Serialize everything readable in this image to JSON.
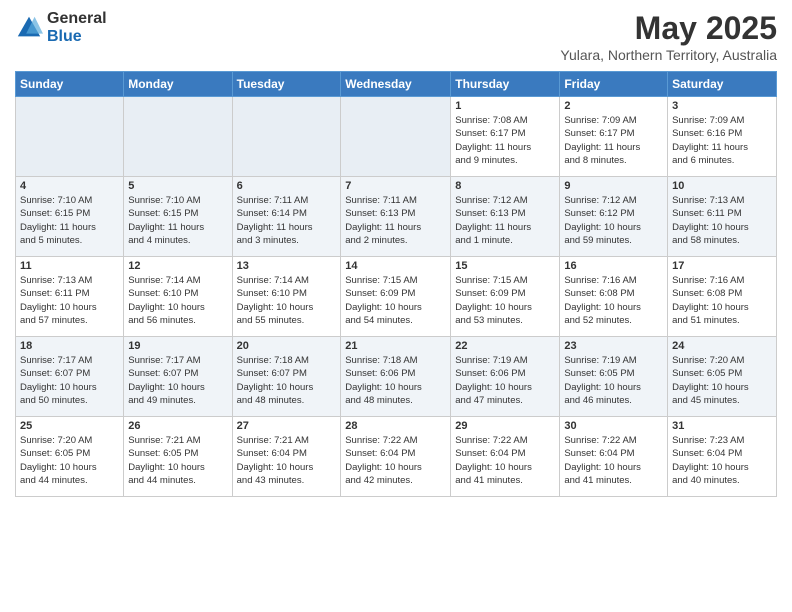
{
  "header": {
    "logo_general": "General",
    "logo_blue": "Blue",
    "month_year": "May 2025",
    "location": "Yulara, Northern Territory, Australia"
  },
  "days_of_week": [
    "Sunday",
    "Monday",
    "Tuesday",
    "Wednesday",
    "Thursday",
    "Friday",
    "Saturday"
  ],
  "weeks": [
    [
      {
        "day": "",
        "info": ""
      },
      {
        "day": "",
        "info": ""
      },
      {
        "day": "",
        "info": ""
      },
      {
        "day": "",
        "info": ""
      },
      {
        "day": "1",
        "info": "Sunrise: 7:08 AM\nSunset: 6:17 PM\nDaylight: 11 hours\nand 9 minutes."
      },
      {
        "day": "2",
        "info": "Sunrise: 7:09 AM\nSunset: 6:17 PM\nDaylight: 11 hours\nand 8 minutes."
      },
      {
        "day": "3",
        "info": "Sunrise: 7:09 AM\nSunset: 6:16 PM\nDaylight: 11 hours\nand 6 minutes."
      }
    ],
    [
      {
        "day": "4",
        "info": "Sunrise: 7:10 AM\nSunset: 6:15 PM\nDaylight: 11 hours\nand 5 minutes."
      },
      {
        "day": "5",
        "info": "Sunrise: 7:10 AM\nSunset: 6:15 PM\nDaylight: 11 hours\nand 4 minutes."
      },
      {
        "day": "6",
        "info": "Sunrise: 7:11 AM\nSunset: 6:14 PM\nDaylight: 11 hours\nand 3 minutes."
      },
      {
        "day": "7",
        "info": "Sunrise: 7:11 AM\nSunset: 6:13 PM\nDaylight: 11 hours\nand 2 minutes."
      },
      {
        "day": "8",
        "info": "Sunrise: 7:12 AM\nSunset: 6:13 PM\nDaylight: 11 hours\nand 1 minute."
      },
      {
        "day": "9",
        "info": "Sunrise: 7:12 AM\nSunset: 6:12 PM\nDaylight: 10 hours\nand 59 minutes."
      },
      {
        "day": "10",
        "info": "Sunrise: 7:13 AM\nSunset: 6:11 PM\nDaylight: 10 hours\nand 58 minutes."
      }
    ],
    [
      {
        "day": "11",
        "info": "Sunrise: 7:13 AM\nSunset: 6:11 PM\nDaylight: 10 hours\nand 57 minutes."
      },
      {
        "day": "12",
        "info": "Sunrise: 7:14 AM\nSunset: 6:10 PM\nDaylight: 10 hours\nand 56 minutes."
      },
      {
        "day": "13",
        "info": "Sunrise: 7:14 AM\nSunset: 6:10 PM\nDaylight: 10 hours\nand 55 minutes."
      },
      {
        "day": "14",
        "info": "Sunrise: 7:15 AM\nSunset: 6:09 PM\nDaylight: 10 hours\nand 54 minutes."
      },
      {
        "day": "15",
        "info": "Sunrise: 7:15 AM\nSunset: 6:09 PM\nDaylight: 10 hours\nand 53 minutes."
      },
      {
        "day": "16",
        "info": "Sunrise: 7:16 AM\nSunset: 6:08 PM\nDaylight: 10 hours\nand 52 minutes."
      },
      {
        "day": "17",
        "info": "Sunrise: 7:16 AM\nSunset: 6:08 PM\nDaylight: 10 hours\nand 51 minutes."
      }
    ],
    [
      {
        "day": "18",
        "info": "Sunrise: 7:17 AM\nSunset: 6:07 PM\nDaylight: 10 hours\nand 50 minutes."
      },
      {
        "day": "19",
        "info": "Sunrise: 7:17 AM\nSunset: 6:07 PM\nDaylight: 10 hours\nand 49 minutes."
      },
      {
        "day": "20",
        "info": "Sunrise: 7:18 AM\nSunset: 6:07 PM\nDaylight: 10 hours\nand 48 minutes."
      },
      {
        "day": "21",
        "info": "Sunrise: 7:18 AM\nSunset: 6:06 PM\nDaylight: 10 hours\nand 48 minutes."
      },
      {
        "day": "22",
        "info": "Sunrise: 7:19 AM\nSunset: 6:06 PM\nDaylight: 10 hours\nand 47 minutes."
      },
      {
        "day": "23",
        "info": "Sunrise: 7:19 AM\nSunset: 6:05 PM\nDaylight: 10 hours\nand 46 minutes."
      },
      {
        "day": "24",
        "info": "Sunrise: 7:20 AM\nSunset: 6:05 PM\nDaylight: 10 hours\nand 45 minutes."
      }
    ],
    [
      {
        "day": "25",
        "info": "Sunrise: 7:20 AM\nSunset: 6:05 PM\nDaylight: 10 hours\nand 44 minutes."
      },
      {
        "day": "26",
        "info": "Sunrise: 7:21 AM\nSunset: 6:05 PM\nDaylight: 10 hours\nand 44 minutes."
      },
      {
        "day": "27",
        "info": "Sunrise: 7:21 AM\nSunset: 6:04 PM\nDaylight: 10 hours\nand 43 minutes."
      },
      {
        "day": "28",
        "info": "Sunrise: 7:22 AM\nSunset: 6:04 PM\nDaylight: 10 hours\nand 42 minutes."
      },
      {
        "day": "29",
        "info": "Sunrise: 7:22 AM\nSunset: 6:04 PM\nDaylight: 10 hours\nand 41 minutes."
      },
      {
        "day": "30",
        "info": "Sunrise: 7:22 AM\nSunset: 6:04 PM\nDaylight: 10 hours\nand 41 minutes."
      },
      {
        "day": "31",
        "info": "Sunrise: 7:23 AM\nSunset: 6:04 PM\nDaylight: 10 hours\nand 40 minutes."
      }
    ]
  ]
}
